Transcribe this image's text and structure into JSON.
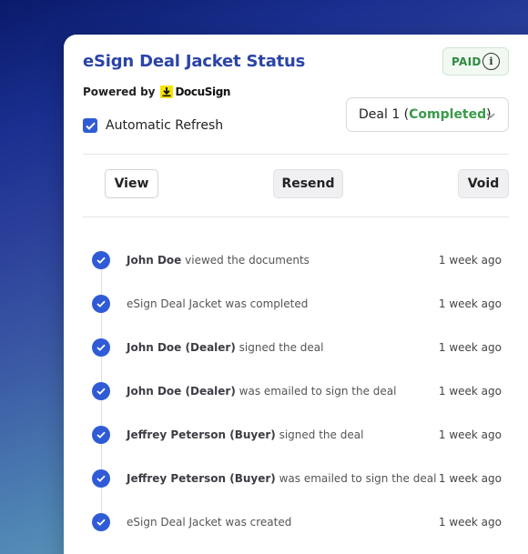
{
  "header": {
    "title": "eSign Deal Jacket Status",
    "badge": "PAID",
    "info_icon": "info-icon",
    "powered_by": "Powered by",
    "brand": "DocuSign"
  },
  "settings": {
    "auto_refresh_label": "Automatic Refresh",
    "auto_refresh_checked": true
  },
  "deal_select": {
    "prefix": "Deal 1 (",
    "status": "Completed",
    "suffix": ")"
  },
  "actions": {
    "view": "View",
    "resend": "Resend",
    "void": "Void"
  },
  "timeline": [
    {
      "actor": "John Doe",
      "text": " viewed the documents",
      "time": "1 week ago"
    },
    {
      "actor": "",
      "text": "eSign Deal Jacket was completed",
      "time": "1 week ago"
    },
    {
      "actor": "John Doe (Dealer)",
      "text": " signed the deal",
      "time": "1 week ago"
    },
    {
      "actor": "John Doe (Dealer)",
      "text": " was emailed to sign the deal",
      "time": "1 week ago"
    },
    {
      "actor": "Jeffrey Peterson (Buyer)",
      "text": " signed the deal",
      "time": "1 week ago"
    },
    {
      "actor": "Jeffrey Peterson (Buyer)",
      "text": " was emailed to sign the deal",
      "time": "1 week ago"
    },
    {
      "actor": "",
      "text": "eSign Deal Jacket was created",
      "time": "1 week ago"
    }
  ],
  "colors": {
    "accent": "#2f5bd6",
    "title": "#2b44a6",
    "paid_green": "#2f8a40",
    "completed_green": "#3a9a4a"
  }
}
